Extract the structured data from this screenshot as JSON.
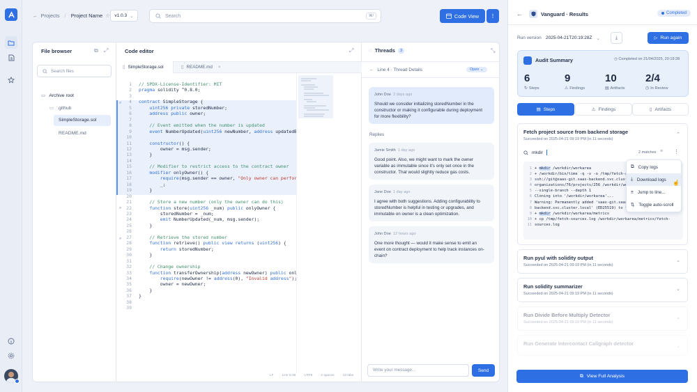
{
  "breadcrumb": {
    "back": "Projects",
    "project": "Project Name",
    "version": "v1.0.3"
  },
  "search": {
    "placeholder": "Search",
    "shortcut": "⌘/"
  },
  "header": {
    "code_view": "Code View"
  },
  "file_browser": {
    "title": "File browser",
    "search_placeholder": "Search files",
    "items": [
      {
        "label": "Archive root",
        "type": "folder"
      },
      {
        "label": ".github",
        "type": "folder"
      },
      {
        "label": "SimpleStorage.sol",
        "type": "file",
        "selected": true
      },
      {
        "label": "README.md",
        "type": "file"
      }
    ]
  },
  "editor": {
    "title": "Code editor",
    "tabs": [
      "SimpleStorage.sol",
      "README.md"
    ],
    "lines": [
      "// SPDX-License-Identifier: MIT",
      "pragma solidity ^0.8.0;",
      "",
      "contract SimpleStorage {",
      "    uint256 private storedNumber;",
      "    address public owner;",
      "",
      "    // Event emitted when the number is updated",
      "    event NumberUpdated(uint256 newNumber, address updatedBy",
      "",
      "    constructor() {",
      "        owner = msg.sender;",
      "    }",
      "",
      "    // Modifier to restrict access to the contract owner",
      "    modifier onlyOwner() {",
      "        require(msg.sender == owner, \"Only owner can perform",
      "        _;",
      "    }",
      "",
      "    // Store a new number (only the owner can do this)",
      "    function store(uint256 _num) public onlyOwner {",
      "        storedNumber = _num;",
      "        emit NumberUpdated(_num, msg.sender);",
      "    }",
      "",
      "    // Retrieve the stored number",
      "    function retrieve() public view returns (uint256) {",
      "        return storedNumber;",
      "    }",
      "",
      "    // Change ownership",
      "    function transferOwnership(address newOwner) public only",
      "        require(newOwner != address(0), \"Invalid address\");",
      "        owner = newOwner;",
      "    }",
      "}",
      "",
      ""
    ],
    "status": [
      "LF",
      "Line 5:36",
      "UTF8",
      "2 spaces",
      "13 tabs"
    ]
  },
  "threads": {
    "title": "Threads",
    "count": "3",
    "detail_title": "Line 4 · Thread Details",
    "status": "Open",
    "root": {
      "author": "John Doe",
      "time": "2 days ago",
      "text": "Should we consider initializing storedNumber in the constructor or making it configurable during deployment for more flexibility?"
    },
    "replies_label": "Replies",
    "replies": [
      {
        "author": "Jamie Smith",
        "time": "1 day ago",
        "text": "Good point. Also, we might want to mark the owner variable as immutable since it's only set once in the constructor. That would slightly reduce gas costs."
      },
      {
        "author": "Jane Doe",
        "time": "1 day ago",
        "text": "I agree with both suggestions. Adding configurability to storedNumber is helpful in testing or upgrades, and immutable on owner is a clean optimization."
      },
      {
        "author": "John Doe",
        "time": "12 hours ago",
        "text": "One more thought — would it make sense to emit an event on contract deployment to help track instances on-chain?"
      }
    ],
    "input_placeholder": "Write your message...",
    "send": "Send"
  },
  "results": {
    "title": "Vanguard · Results",
    "status": "Completed",
    "run_version_label": "Run version",
    "run_version": "2025-04-21T20:19:28Z",
    "run_again": "Run again",
    "summary_title": "Audit Summary",
    "completed_on": "Completed on 21/04/2025, 20:19:28",
    "stats": [
      {
        "value": "6",
        "label": "Steps"
      },
      {
        "value": "9",
        "label": "Findings"
      },
      {
        "value": "10",
        "label": "Artifacts"
      },
      {
        "value": "2/4",
        "label": "In Review"
      }
    ],
    "tabs": [
      "Steps",
      "Findings",
      "Artifacts"
    ],
    "steps": [
      {
        "title": "Fetch project source from backend storage",
        "sub": "Succeeded on 2025-04-21 09:19 PM (in 11 seconds)"
      },
      {
        "title": "Run pyul with solidity output",
        "sub": "Succeeded on 2025-04-21 09:19 PM (in 11 seconds)"
      },
      {
        "title": "Run solidity summarizer",
        "sub": "Succeeded on 2025-04-21 09:19 PM (in 11 seconds)"
      },
      {
        "title": "Run Divide Before Multiply Detector",
        "sub": "Succeeded on 2025-04-21 09:19 PM (in 11 seconds)"
      },
      {
        "title": "Run Generate Intercontact Callgraph detector",
        "sub": ""
      }
    ],
    "log_search": "mkdir",
    "log_matches": "2 matches",
    "log_lines": [
      "+ mkdir /workdir/workarea",
      "+ /workdir/bin/time -q -v -o /tmp/fetch-a",
      "ssh://git@saas-git.saas-backend.svc.clust",
      "organizations/76/projects/256 /workdir/wo",
      "--single-branch --depth 1",
      "Cloning into '/workdir/workarea'...",
      "Warning: Permanently added 'saas-git.saas",
      "backend.svc.cluster.local' (ED25519) to t",
      "+ mkdir /workdir/workarea/metrics",
      "+ cp /tmp/fetch-sources.log /workdir/workarea/metrics/fetch-",
      "sources.log"
    ],
    "menu": [
      "Copy logs",
      "Download logs",
      "Jump to line...",
      "Toggle auto-scroll"
    ],
    "view_full": "View Full Analysis"
  }
}
